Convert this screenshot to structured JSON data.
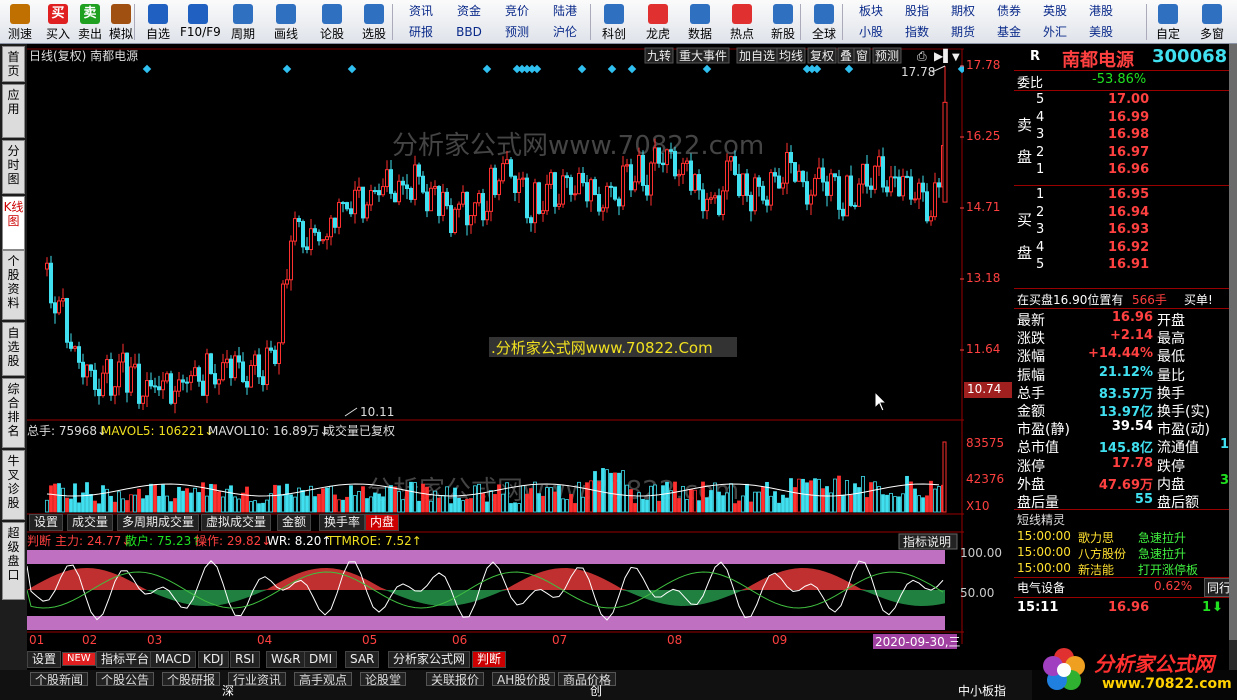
{
  "toolbar": {
    "buttons": [
      {
        "label": "测速",
        "icon": "clock-icon",
        "color": "#c07000"
      },
      {
        "label": "买入",
        "icon": "buy-icon",
        "color": "#e02020",
        "glyph": "买"
      },
      {
        "label": "卖出",
        "icon": "sell-icon",
        "color": "#20a020",
        "glyph": "卖"
      },
      {
        "label": "模拟",
        "icon": "gavel-icon",
        "color": "#a05010"
      },
      {
        "label": "自选",
        "icon": "star-icon",
        "color": "#2060c0"
      },
      {
        "label": "F10/F9",
        "icon": "f10-icon",
        "color": "#2060c0"
      },
      {
        "label": "周期",
        "icon": "clock-cycle-icon",
        "color": "#3070c0"
      },
      {
        "label": "画线",
        "icon": "pen-icon",
        "color": "#3070c0"
      },
      {
        "label": "论股",
        "icon": "discuss-icon",
        "color": "#3070c0"
      },
      {
        "label": "选股",
        "icon": "select-stock-icon",
        "color": "#3070c0"
      },
      {
        "label": "科创",
        "icon": "kechuang-icon",
        "color": "#3070c0"
      },
      {
        "label": "龙虎",
        "icon": "dragon-icon",
        "color": "#e03030"
      },
      {
        "label": "数据",
        "icon": "pe-icon",
        "color": "#3070c0"
      },
      {
        "label": "热点",
        "icon": "hot-icon",
        "color": "#e03030"
      },
      {
        "label": "新股",
        "icon": "newstock-icon",
        "color": "#3070c0"
      },
      {
        "label": "全球",
        "icon": "globe-icon",
        "color": "#3070c0"
      },
      {
        "label": "自定",
        "icon": "custom-icon",
        "color": "#3070c0"
      },
      {
        "label": "多窗",
        "icon": "multiwindow-icon",
        "color": "#3070c0"
      }
    ],
    "groups": [
      [
        "资讯",
        "研报"
      ],
      [
        "资金",
        "BBD"
      ],
      [
        "竞价",
        "预测"
      ],
      [
        "陆港",
        "沪伦"
      ],
      [
        "板块",
        "小股"
      ],
      [
        "股指",
        "指数"
      ],
      [
        "期权",
        "期货"
      ],
      [
        "债券",
        "基金"
      ],
      [
        "英股",
        "外汇"
      ],
      [
        "港股",
        "美股"
      ]
    ]
  },
  "side_tabs": [
    "首页",
    "应用",
    "分时图",
    "K线图",
    "个股资料",
    "自选股",
    "综合排名",
    "牛叉诊股",
    "超级盘口"
  ],
  "chart": {
    "header_left": "日线(复权) 南都电源",
    "menu": [
      "九转",
      "重大事件",
      "加自选",
      "均线",
      "复权",
      "叠",
      "窗",
      "预测"
    ],
    "price_axis": [
      "17.78",
      "16.25",
      "14.71",
      "13.18",
      "11.64"
    ],
    "current_price_label": "10.74",
    "high_label": "17.78",
    "low_label": "10.11",
    "watermark1": "分析家公式网www.70822.com",
    "watermark2": ".分析家公式网www.70822.Com",
    "watermark3": "分析家公式网www.70822.com",
    "volume_header": {
      "total": "总手: 75968↓",
      "mavol5": "MAVOL5: 106221↓",
      "mavol10": "MAVOL10: 16.89万↓",
      "note": "成交量已复权"
    },
    "volume_axis": [
      "83575",
      "42376",
      "X10"
    ],
    "panel_tabs": [
      "设置",
      "成交量",
      "多周期成交量",
      "虚拟成交量",
      "金额",
      "换手率",
      "内盘"
    ],
    "indicator_header": {
      "name": "判断",
      "main": "主力: 24.77↓",
      "retail": "散户: 75.23↑",
      "op": "操作: 29.82↓",
      "wr": "WR: 8.20↑",
      "ttm": "TTMROE: 7.52↑"
    },
    "indicator_help": "指标说明",
    "indicator_axis": [
      "100.00",
      "50.00"
    ],
    "months": [
      "01",
      "02",
      "03",
      "04",
      "05",
      "06",
      "07",
      "08",
      "09"
    ],
    "date_label": "2020-09-30,三",
    "bottom_tabs": [
      "设置",
      "NEW",
      "指标平台",
      "MACD",
      "KDJ",
      "RSI",
      "W&R",
      "DMI",
      "SAR",
      "分析家公式网",
      "判断"
    ]
  },
  "quote": {
    "title": "南都电源",
    "code": "300068",
    "r_mark": "R",
    "weibi_label": "委比",
    "weibi": "-53.86%",
    "sell_label": [
      "卖",
      "盘"
    ],
    "buy_label": [
      "买",
      "盘"
    ],
    "asks": [
      [
        "5",
        "17.00"
      ],
      [
        "4",
        "16.99"
      ],
      [
        "3",
        "16.98"
      ],
      [
        "2",
        "16.97"
      ],
      [
        "1",
        "16.96"
      ]
    ],
    "bids": [
      [
        "1",
        "16.95"
      ],
      [
        "2",
        "16.94"
      ],
      [
        "3",
        "16.93"
      ],
      [
        "4",
        "16.92"
      ],
      [
        "5",
        "16.91"
      ]
    ],
    "notice": {
      "text": "在买盘16.90位置有",
      "qty": "566手",
      "action": "买单!"
    },
    "stats": [
      [
        "最新",
        "16.96",
        "red",
        "开盘"
      ],
      [
        "涨跌",
        "+2.14",
        "red",
        "最高"
      ],
      [
        "涨幅",
        "+14.44%",
        "red",
        "最低"
      ],
      [
        "振幅",
        "21.12%",
        "cyan",
        "量比"
      ],
      [
        "总手",
        "83.57万",
        "cyan",
        "换手"
      ],
      [
        "金额",
        "13.97亿",
        "cyan",
        "换手(实)"
      ],
      [
        "市盈(静)",
        "39.54",
        "wht",
        "市盈(动)"
      ],
      [
        "总市值",
        "145.8亿",
        "cyan",
        "流通值"
      ],
      [
        "涨停",
        "17.78",
        "red",
        "跌停"
      ],
      [
        "外盘",
        "47.69万",
        "red",
        "内盘"
      ],
      [
        "盘后量",
        "55",
        "cyan",
        "盘后额"
      ]
    ],
    "right_extra": [
      "1",
      "3"
    ],
    "elf_title": "短线精灵",
    "elf": [
      [
        "15:00:00",
        "歌力思",
        "急速拉升"
      ],
      [
        "15:00:00",
        "八方股份",
        "急速拉升"
      ],
      [
        "15:00:00",
        "新洁能",
        "打开涨停板"
      ]
    ],
    "sector": {
      "name": "电气设备",
      "pct": "0.62%",
      "btn": "同行"
    },
    "tick": {
      "time": "15:11",
      "price": "16.96",
      "vol": "1"
    }
  },
  "bottom": {
    "tabs": [
      "个股新闻",
      "个股公告",
      "个股研报",
      "行业资讯",
      "高手观点",
      "论股堂",
      "关联报价",
      "AH股价股",
      "商品价格"
    ],
    "left": "深",
    "mid": "创",
    "right": "中小板指"
  },
  "logo": {
    "text": "分析家公式网",
    "url": "www.70822.com"
  }
}
